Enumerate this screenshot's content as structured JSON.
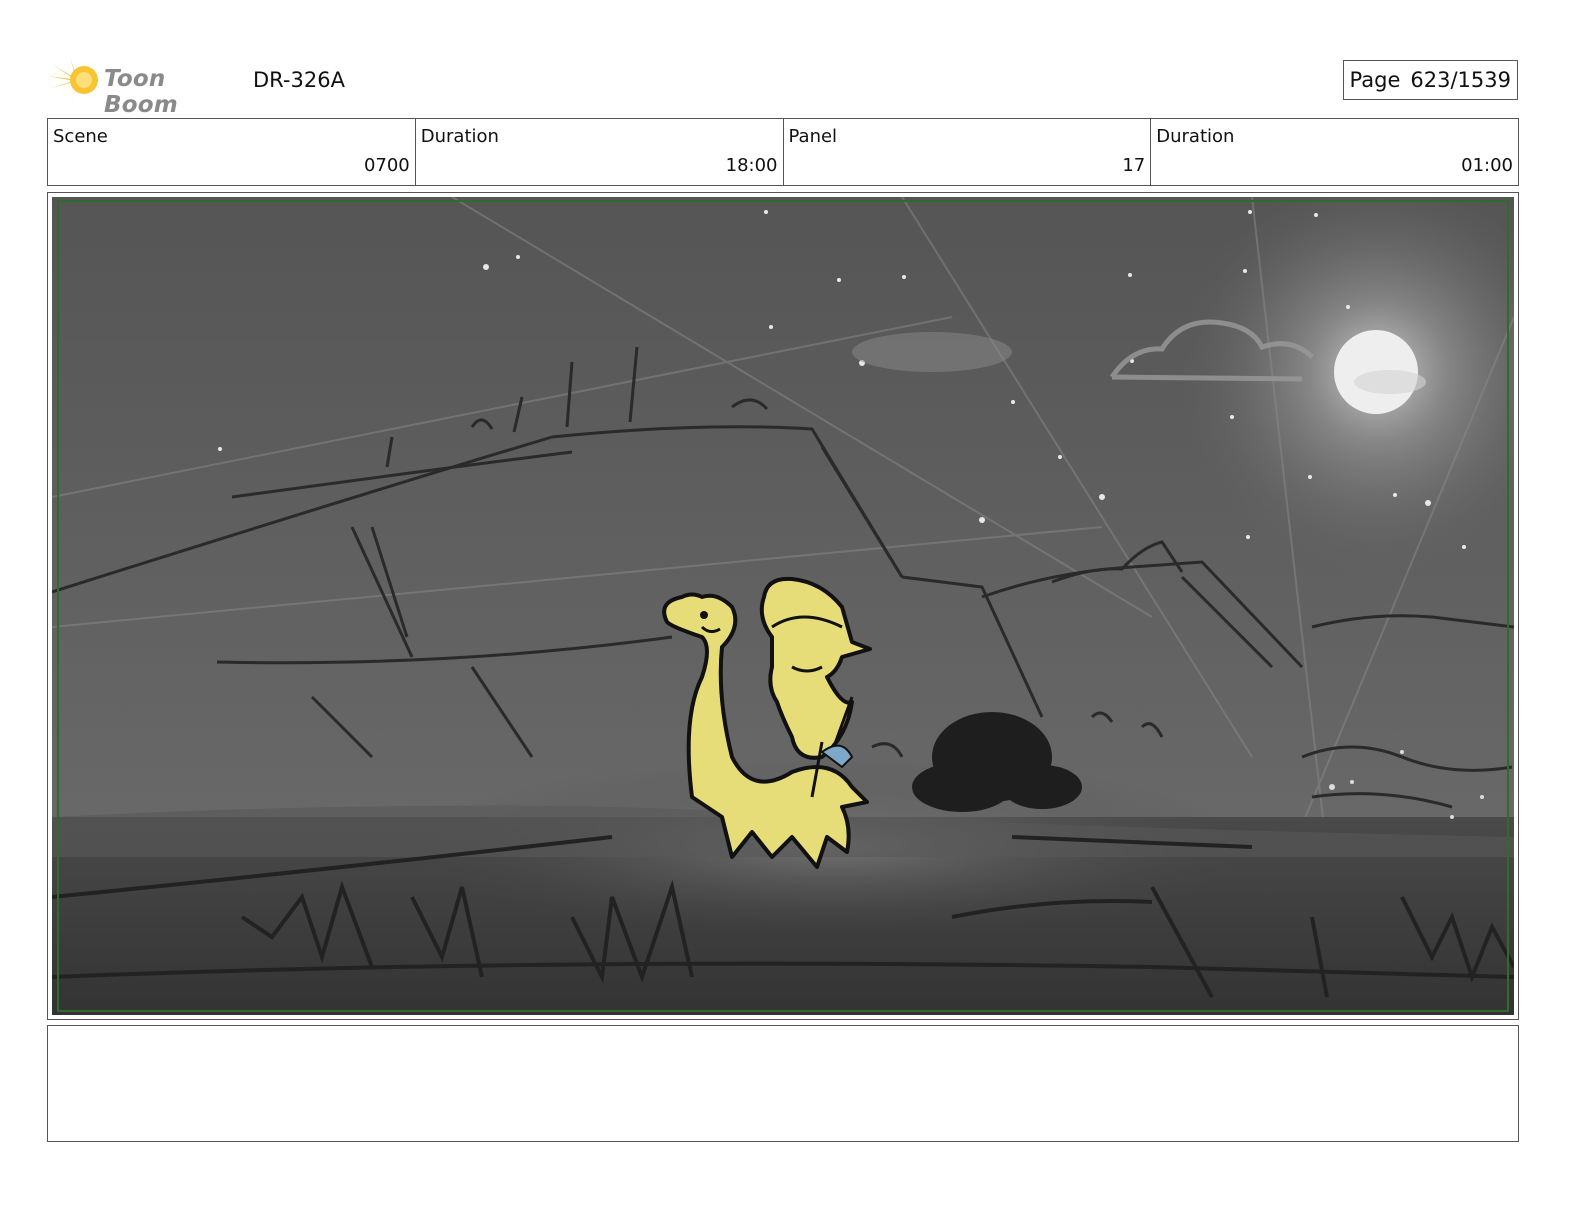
{
  "header": {
    "logo_text": "Toon Boom",
    "production_id": "DR-326A",
    "page_label": "Page",
    "page_number": "623/1539"
  },
  "info": [
    {
      "label": "Scene",
      "value": "0700"
    },
    {
      "label": "Duration",
      "value": "18:00"
    },
    {
      "label": "Panel",
      "value": "17"
    },
    {
      "label": "Duration",
      "value": "01:00"
    }
  ],
  "panel": {
    "description": "",
    "colors": {
      "sky": "#5e5e5e",
      "ground": "#3c3c3c",
      "character_fill": "#e6dc78",
      "safe_frame": "#2f6b2f"
    }
  },
  "notes": {
    "text": ""
  }
}
